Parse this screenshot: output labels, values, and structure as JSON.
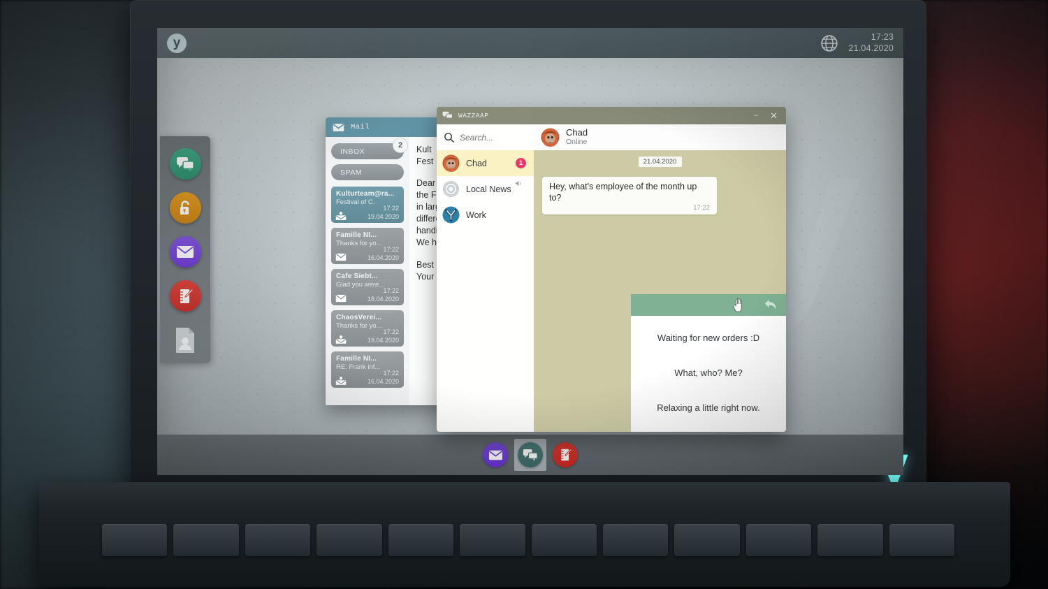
{
  "os": {
    "logo_text": "y",
    "globe_icon": "globe-icon",
    "clock_time": "17:23",
    "clock_date": "21.04.2020"
  },
  "laptop": {
    "brand_logo": "y"
  },
  "dock": {
    "items": [
      {
        "name": "chat-app",
        "icon": "chat-bubbles-icon"
      },
      {
        "name": "unlock-app",
        "icon": "padlock-open-icon"
      },
      {
        "name": "mail-app",
        "icon": "envelope-icon"
      },
      {
        "name": "notes-app",
        "icon": "notepad-pencil-icon"
      },
      {
        "name": "contacts-app",
        "icon": "contact-card-icon"
      }
    ]
  },
  "taskbar": {
    "items": [
      {
        "name": "mail",
        "icon": "envelope-icon",
        "active": false
      },
      {
        "name": "chat",
        "icon": "chat-bubbles-icon",
        "active": true
      },
      {
        "name": "notes",
        "icon": "notepad-pencil-icon",
        "active": false
      }
    ]
  },
  "mail_window": {
    "title": "Mail",
    "title_icon": "envelope-icon",
    "folders": [
      {
        "label": "INBOX",
        "badge": "2"
      },
      {
        "label": "SPAM",
        "badge": ""
      }
    ],
    "messages": [
      {
        "from": "Kulturteam@ra...",
        "subject": "Festival of C.",
        "time": "17:22",
        "date": "19.04.2020",
        "icon": "mail-person-icon",
        "selected": true
      },
      {
        "from": "Famille NI...",
        "subject": "Thanks for yo...",
        "time": "17:22",
        "date": "16.04.2020",
        "icon": "envelope-icon",
        "selected": false
      },
      {
        "from": "Cafe Siebt...",
        "subject": "Glad you were...",
        "time": "17:22",
        "date": "18.04.2020",
        "icon": "envelope-icon",
        "selected": false
      },
      {
        "from": "ChaosVerei...",
        "subject": "Thanks for yo...",
        "time": "17:22",
        "date": "19.04.2020",
        "icon": "mail-person-icon",
        "selected": false
      },
      {
        "from": "Famille NI...",
        "subject": "RE: Frank inf...",
        "time": "17:22",
        "date": "16.04.2020",
        "icon": "mail-person-icon",
        "selected": false
      }
    ],
    "reading_pane": {
      "subject_line1": "Kult",
      "subject_line2": "Fest",
      "body_lines": [
        "Dear fe",
        "the Fest",
        "in large",
        "differen",
        "handicr",
        "We hop"
      ],
      "signoff_lines": [
        "Best reg",
        "Your Cu"
      ]
    }
  },
  "messenger": {
    "title": "WAZZAAP",
    "title_icon": "chat-bubbles-icon",
    "minimize_label": "–",
    "close_label": "✕",
    "search_placeholder": "Search...",
    "search_value": "",
    "search_icon": "search-icon",
    "contacts": [
      {
        "name": "Chad",
        "badge": "1",
        "avatar": "chad-avatar",
        "active": true,
        "muted_icon": ""
      },
      {
        "name": "Local News",
        "badge": "",
        "avatar": "gear-icon",
        "active": false,
        "muted_icon": "speaker-icon"
      },
      {
        "name": "Work",
        "badge": "",
        "avatar": "y-logo-icon",
        "active": false,
        "muted_icon": ""
      }
    ],
    "conversation": {
      "contact_name": "Chad",
      "contact_status": "Online",
      "avatar": "chad-avatar",
      "date_separator": "21.04.2020",
      "messages": [
        {
          "text": "Hey, what's employee of the month up to?",
          "time": "17:22",
          "from": "them"
        }
      ]
    },
    "reply_panel": {
      "back_icon": "reply-arrow-icon",
      "cursor_icon": "hand-cursor-icon",
      "options": [
        "Waiting for new orders :D",
        "What, who? Me?",
        "Relaxing a little right now."
      ]
    }
  },
  "colors": {
    "accent_green": "#7fb194",
    "chat_bg": "#cdcba5",
    "mail_title": "#5e93a4",
    "badge_pink": "#ea3768",
    "brand_cyan": "#6df0ec"
  }
}
